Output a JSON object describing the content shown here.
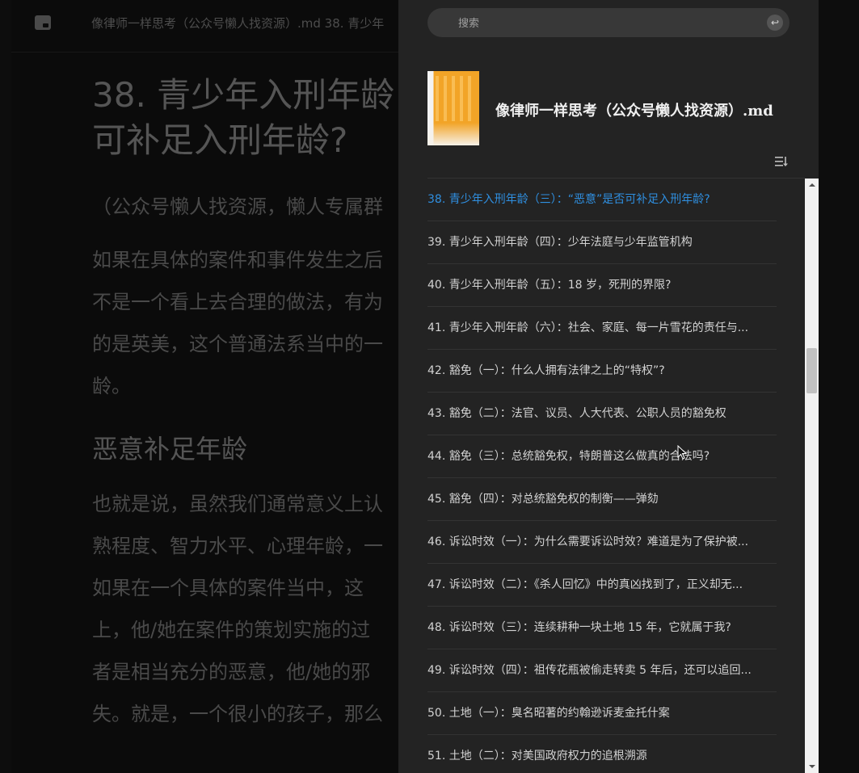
{
  "reader": {
    "title": "像律师一样思考（公众号懒人找资源）.md 38. 青少年",
    "heading": "38. 青少年入刑年龄\n可补足入刑年龄?",
    "para1": "（公众号懒人找资源，懒人专属群",
    "para2": "如果在具体的案件和事件发生之后\n不是一个看上去合理的做法，有为\n的是英美，这个普通法系当中的一\n龄。",
    "subheading": "恶意补足年龄",
    "para3": "也就是说，虽然我们通常意义上认\n熟程度、智力水平、心理年龄，一\n如果在一个具体的案件当中，这\n上，他/她在案件的策划实施的过\n者是相当充分的恶意，他/她的邪\n失。就是，一个很小的孩子，那么"
  },
  "search": {
    "placeholder": "搜索",
    "enter_icon": "↩"
  },
  "book": {
    "title": "像律师一样思考（公众号懒人找资源）.md"
  },
  "toc": {
    "active_index": 0,
    "items": [
      "38. 青少年入刑年龄（三）：“恶意”是否可补足入刑年龄?",
      "39. 青少年入刑年龄（四）：少年法庭与少年监管机构",
      "40. 青少年入刑年龄（五）：18 岁，死刑的界限?",
      "41. 青少年入刑年龄（六）：社会、家庭、每一片雪花的责任与...",
      "42. 豁免（一）：什么人拥有法律之上的“特权”?",
      "43. 豁免（二）：法官、议员、人大代表、公职人员的豁免权",
      "44. 豁免（三）：总统豁免权，特朗普这么做真的合法吗?",
      "45. 豁免（四）：对总统豁免权的制衡——弹劾",
      "46. 诉讼时效（一）：为什么需要诉讼时效？难道是为了保护被...",
      "47. 诉讼时效（二）：《杀人回忆》中的真凶找到了，正义却无...",
      "48. 诉讼时效（三）：连续耕种一块土地 15 年，它就属于我?",
      "49. 诉讼时效（四）：祖传花瓶被偷走转卖 5 年后，还可以追回...",
      "50. 土地（一）：臭名昭著的约翰逊诉麦金托什案",
      "51. 土地（二）：对美国政府权力的追根溯源"
    ]
  },
  "colors": {
    "active": "#2f8fe0",
    "panel_bg": "#232323",
    "reader_bg": "#0b0b0b"
  }
}
